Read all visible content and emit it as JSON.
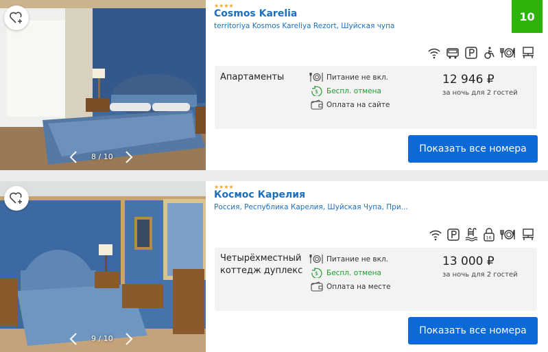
{
  "colors": {
    "accent": "#0b6ad8",
    "link": "#1a6fc0",
    "score_bg": "#2db40b",
    "stars": "#f5a623",
    "free_cancel": "#1f9a2f"
  },
  "hotels": [
    {
      "stars": "★★★★",
      "name": "Cosmos Karelia",
      "address": "territoriya Kosmos Kareliya Rezort, Шуйская чупа",
      "score": "10",
      "photo_counter": "8 / 10",
      "amenities": [
        "wifi-icon",
        "transfer-icon",
        "parking-icon",
        "accessible-icon",
        "restaurant-icon",
        "business-center-icon"
      ],
      "room_type": "Апартаменты",
      "meal": "Питание не вкл.",
      "cancel": "Беспл. отмена",
      "payment": "Оплата на сайте",
      "price": "12 946 ₽",
      "price_note": "за ночь для 2 гостей",
      "button": "Показать все номера"
    },
    {
      "stars": "★★★★",
      "name": "Космос Карелия",
      "address": "Россия, Республика Карелия, Шуйская Чупа, При...",
      "photo_counter": "9 / 10",
      "amenities": [
        "wifi-icon",
        "parking-icon",
        "pool-icon",
        "age-limit-icon",
        "restaurant-icon",
        "business-center-icon"
      ],
      "room_type": "Четырёхместный\nкоттедж дуплекс",
      "meal": "Питание не вкл.",
      "cancel": "Беспл. отмена",
      "payment": "Оплата на месте",
      "price": "13 000 ₽",
      "price_note": "за ночь для 2 гостей",
      "button": "Показать все номера"
    }
  ]
}
